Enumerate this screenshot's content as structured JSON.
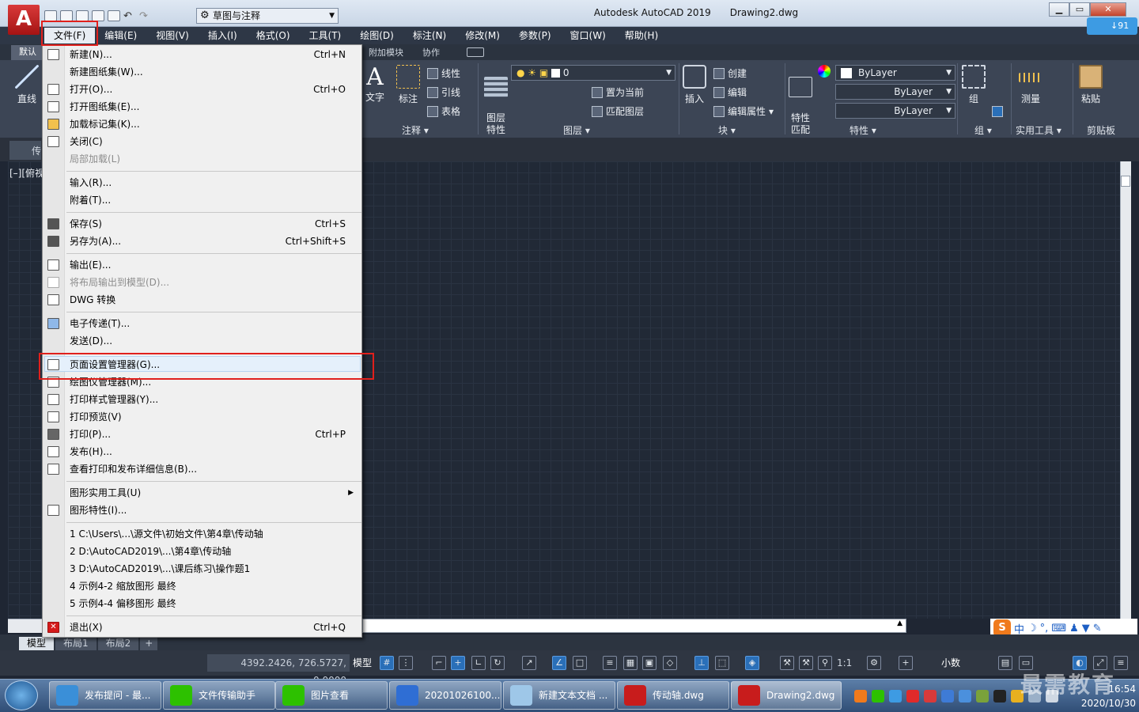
{
  "app": {
    "logo_letter": "A",
    "title": "Autodesk AutoCAD 2019",
    "document": "Drawing2.dwg",
    "workspace": "草图与注释"
  },
  "window_buttons": {
    "minimize": "▁",
    "maximize": "▭",
    "close": "✕"
  },
  "menubar": [
    "文件(F)",
    "编辑(E)",
    "视图(V)",
    "插入(I)",
    "格式(O)",
    "工具(T)",
    "绘图(D)",
    "标注(N)",
    "修改(M)",
    "参数(P)",
    "窗口(W)",
    "帮助(H)"
  ],
  "ribbon_tabs": {
    "home": "默认",
    "addins": "附加模块",
    "collaborate": "协作"
  },
  "ribbon": {
    "line": "直线",
    "text": "文字",
    "dimension": "标注",
    "linear": "线性",
    "leader": "引线",
    "table": "表格",
    "annotation_panel": "注释",
    "layer_props": "图层\n特性",
    "layer_value": "0",
    "set_current": "置为当前",
    "match_layer": "匹配图层",
    "layers_panel": "图层",
    "insert": "插入",
    "create": "创建",
    "edit": "编辑",
    "edit_attr": "编辑属性",
    "block_panel": "块",
    "match_props": "特性\n匹配",
    "bylayer": "ByLayer",
    "properties_panel": "特性",
    "group": "组",
    "group_panel": "组",
    "measure": "测量",
    "utilities_panel": "实用工具",
    "paste": "粘贴",
    "clipboard_panel": "剪贴板"
  },
  "file_tab": "传",
  "view_label": "[–][俯视",
  "file_menu": {
    "items": [
      {
        "label": "新建(N)...",
        "shortcut": "Ctrl+N",
        "disabled": false
      },
      {
        "label": "新建图纸集(W)...",
        "shortcut": "",
        "disabled": false
      },
      {
        "label": "打开(O)...",
        "shortcut": "Ctrl+O",
        "disabled": false
      },
      {
        "label": "打开图纸集(E)...",
        "shortcut": "",
        "disabled": false
      },
      {
        "label": "加载标记集(K)...",
        "shortcut": "",
        "disabled": false
      },
      {
        "label": "关闭(C)",
        "shortcut": "",
        "disabled": false
      },
      {
        "label": "局部加载(L)",
        "shortcut": "",
        "disabled": true
      },
      {
        "label": "输入(R)...",
        "shortcut": "",
        "disabled": false
      },
      {
        "label": "附着(T)...",
        "shortcut": "",
        "disabled": false
      },
      {
        "label": "保存(S)",
        "shortcut": "Ctrl+S",
        "disabled": false
      },
      {
        "label": "另存为(A)...",
        "shortcut": "Ctrl+Shift+S",
        "disabled": false
      },
      {
        "label": "输出(E)...",
        "shortcut": "",
        "disabled": false
      },
      {
        "label": "将布局输出到模型(D)...",
        "shortcut": "",
        "disabled": true
      },
      {
        "label": "DWG 转换",
        "shortcut": "",
        "disabled": false
      },
      {
        "label": "电子传递(T)...",
        "shortcut": "",
        "disabled": false
      },
      {
        "label": "发送(D)...",
        "shortcut": "",
        "disabled": false
      },
      {
        "label": "页面设置管理器(G)...",
        "shortcut": "",
        "disabled": false
      },
      {
        "label": "绘图仪管理器(M)...",
        "shortcut": "",
        "disabled": false
      },
      {
        "label": "打印样式管理器(Y)...",
        "shortcut": "",
        "disabled": false
      },
      {
        "label": "打印预览(V)",
        "shortcut": "",
        "disabled": false
      },
      {
        "label": "打印(P)...",
        "shortcut": "Ctrl+P",
        "disabled": false
      },
      {
        "label": "发布(H)...",
        "shortcut": "",
        "disabled": false
      },
      {
        "label": "查看打印和发布详细信息(B)...",
        "shortcut": "",
        "disabled": false
      },
      {
        "label": "图形实用工具(U)",
        "shortcut": "",
        "disabled": false
      },
      {
        "label": "图形特性(I)...",
        "shortcut": "",
        "disabled": false
      },
      {
        "label": "1 C:\\Users\\...\\源文件\\初始文件\\第4章\\传动轴",
        "shortcut": "",
        "disabled": false
      },
      {
        "label": "2 D:\\AutoCAD2019\\...\\第4章\\传动轴",
        "shortcut": "",
        "disabled": false
      },
      {
        "label": "3 D:\\AutoCAD2019\\...\\课后练习\\操作题1",
        "shortcut": "",
        "disabled": false
      },
      {
        "label": "4 示例4-2 缩放图形 最终",
        "shortcut": "",
        "disabled": false
      },
      {
        "label": "5 示例4-4 偏移图形 最终",
        "shortcut": "",
        "disabled": false
      },
      {
        "label": "退出(X)",
        "shortcut": "Ctrl+Q",
        "disabled": false
      }
    ]
  },
  "layout_tabs": [
    "模型",
    "布局1",
    "布局2",
    "+"
  ],
  "status": {
    "coords": "4392.2426, 726.5727, 0.0000",
    "model": "模型",
    "scale": "1:1",
    "units": "小数"
  },
  "ime": {
    "logo": "S",
    "mode": "中"
  },
  "taskbar": {
    "items": [
      "发布提问 - 最...",
      "文件传输助手",
      "图片查看",
      "20201026100...",
      "新建文本文档 ...",
      "传动轴.dwg",
      "Drawing2.dwg"
    ],
    "time": "16:54",
    "date": "2020/10/30"
  },
  "watermark": "最需教育",
  "cloud_badge": "↓91",
  "colors": {
    "highlight": "#e0201c",
    "canvas": "#212936",
    "menu_bg": "#f0f0f0"
  }
}
